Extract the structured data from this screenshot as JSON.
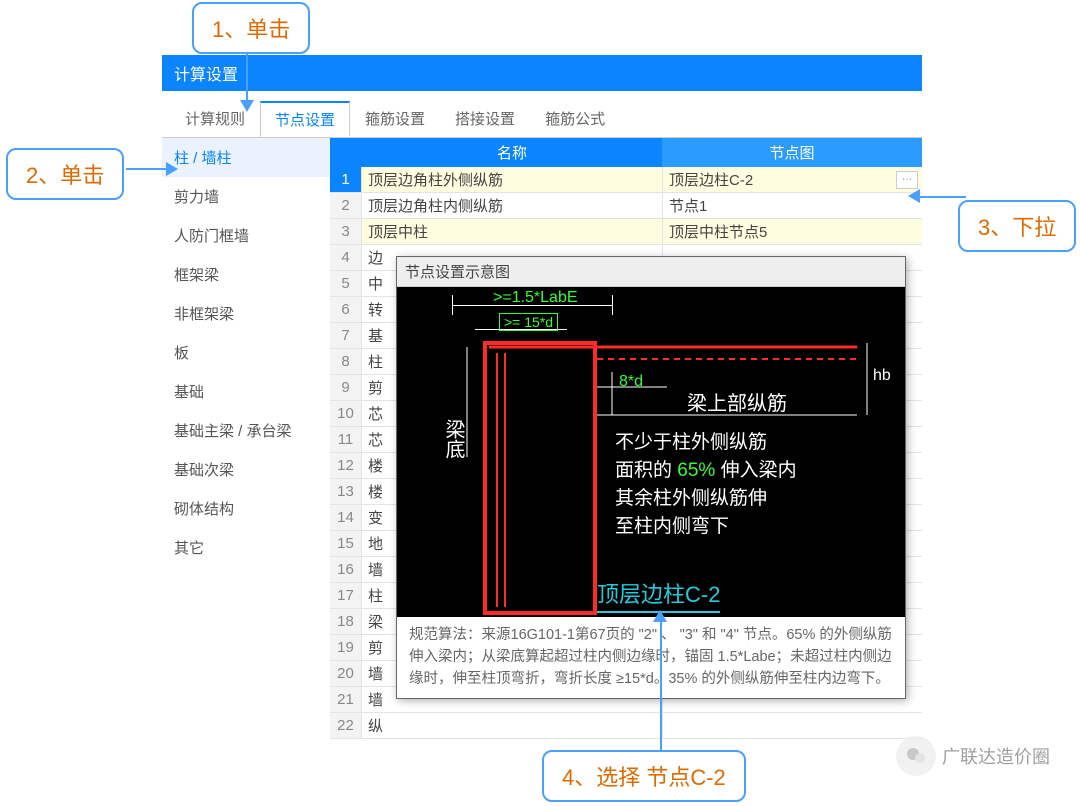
{
  "window_title": "计算设置",
  "tabs": [
    "计算规则",
    "节点设置",
    "箍筋设置",
    "搭接设置",
    "箍筋公式"
  ],
  "active_tab": 1,
  "sidebar": {
    "active": 0,
    "items": [
      "柱 / 墙柱",
      "剪力墙",
      "人防门框墙",
      "框架梁",
      "非框架梁",
      "板",
      "基础",
      "基础主梁 / 承台梁",
      "基础次梁",
      "砌体结构",
      "其它"
    ]
  },
  "grid": {
    "headers": {
      "name": "名称",
      "fig": "节点图"
    },
    "rows": [
      {
        "n": 1,
        "name": "顶层边角柱外侧纵筋",
        "fig": "顶层边柱C-2",
        "hl": true,
        "sel": true,
        "drop": true
      },
      {
        "n": 2,
        "name": "顶层边角柱内侧纵筋",
        "fig": "节点1"
      },
      {
        "n": 3,
        "name": "顶层中柱",
        "fig": "顶层中柱节点5",
        "hl": true
      },
      {
        "n": 4,
        "name": "边",
        "fig": ""
      },
      {
        "n": 5,
        "name": "中",
        "fig": ""
      },
      {
        "n": 6,
        "name": "转",
        "fig": ""
      },
      {
        "n": 7,
        "name": "基",
        "fig": ""
      },
      {
        "n": 8,
        "name": "柱",
        "fig": ""
      },
      {
        "n": 9,
        "name": "剪",
        "fig": ""
      },
      {
        "n": 10,
        "name": "芯",
        "fig": ""
      },
      {
        "n": 11,
        "name": "芯",
        "fig": ""
      },
      {
        "n": 12,
        "name": "楼",
        "fig": ""
      },
      {
        "n": 13,
        "name": "楼",
        "fig": ""
      },
      {
        "n": 14,
        "name": "变",
        "fig": ""
      },
      {
        "n": 15,
        "name": "地",
        "fig": ""
      },
      {
        "n": 16,
        "name": "墙",
        "fig": ""
      },
      {
        "n": 17,
        "name": "柱",
        "fig": ""
      },
      {
        "n": 18,
        "name": "梁",
        "fig": ""
      },
      {
        "n": 19,
        "name": "剪",
        "fig": ""
      },
      {
        "n": 20,
        "name": "墙",
        "fig": ""
      },
      {
        "n": 21,
        "name": "墙",
        "fig": ""
      },
      {
        "n": 22,
        "name": "纵",
        "fig": ""
      }
    ]
  },
  "popup": {
    "title": "节点设置示意图",
    "diagram": {
      "lab_e": ">=1.5*LabE",
      "d15": ">= 15*d",
      "d8": "8*d",
      "hb": "hb",
      "beam": "梁上部纵筋",
      "beam_bot": "梁底",
      "desc1": "不少于柱外侧纵筋",
      "desc2_a": "面积的 ",
      "desc2_pct": "65%",
      "desc2_b": " 伸入梁内",
      "desc3": "其余柱外侧纵筋伸",
      "desc4": "至柱内侧弯下",
      "caption": "顶层边柱C-2"
    },
    "foot_text": "规范算法：来源16G101-1第67页的 \"2\" 、 \"3\" 和 \"4\" 节点。65% 的外侧纵筋伸入梁内；从梁底算起超过柱内侧边缘时，锚固 1.5*Labe；未超过柱内侧边缘时，伸至柱顶弯折，弯折长度 ≥15*d。35% 的外侧纵筋伸至柱内边弯下。"
  },
  "callouts": {
    "c1": "1、单击",
    "c2": "2、单击",
    "c3": "3、下拉",
    "c4": "4、选择 节点C-2"
  },
  "watermark": "广联达造价圈"
}
